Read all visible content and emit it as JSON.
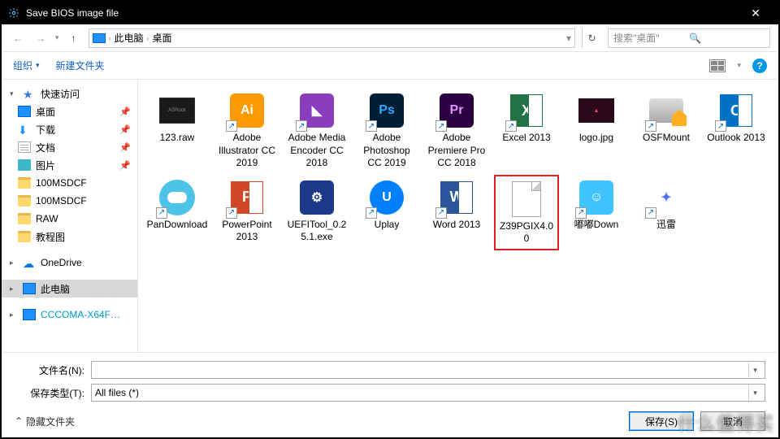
{
  "title": "Save BIOS image file",
  "breadcrumbs": {
    "root": "此电脑",
    "current": "桌面"
  },
  "search_placeholder": "搜索\"桌面\"",
  "cmdbar": {
    "organize": "组织",
    "newfolder": "新建文件夹"
  },
  "sidebar": {
    "quick": "快速访问",
    "desktop": "桌面",
    "downloads": "下载",
    "documents": "文档",
    "pictures": "图片",
    "f1": "100MSDCF",
    "f2": "100MSDCF",
    "f3": "RAW",
    "f4": "教程图",
    "onedrive": "OneDrive",
    "thispc": "此电脑",
    "net": "CCCOMA-X64F…"
  },
  "items": {
    "r1c1": "123.raw",
    "r1c2": "Adobe Illustrator CC 2019",
    "r1c3": "Adobe Media Encoder CC 2018",
    "r1c4": "Adobe Photoshop CC 2019",
    "r1c5": "Adobe Premiere Pro CC 2018",
    "r1c6": "Excel 2013",
    "r1c7": "logo.jpg",
    "r1c8": "OSFMount",
    "r1c9": "Outlook 2013",
    "r1c10": "PanDownload",
    "r2c1": "PowerPoint 2013",
    "r2c2": "UEFITool_0.25.1.exe",
    "r2c3": "Uplay",
    "r2c4": "Word 2013",
    "r2c5": "Z39PGIX4.00",
    "r2c6": "嘟嘟Down",
    "r2c7": "迅雷"
  },
  "form": {
    "filename_label": "文件名(N):",
    "filetype_label": "保存类型(T):",
    "filetype_value": "All files (*)",
    "filename_value": ""
  },
  "footer": {
    "hide": "隐藏文件夹",
    "save": "保存(S)",
    "cancel": "取消"
  },
  "watermark": "什么值得买"
}
